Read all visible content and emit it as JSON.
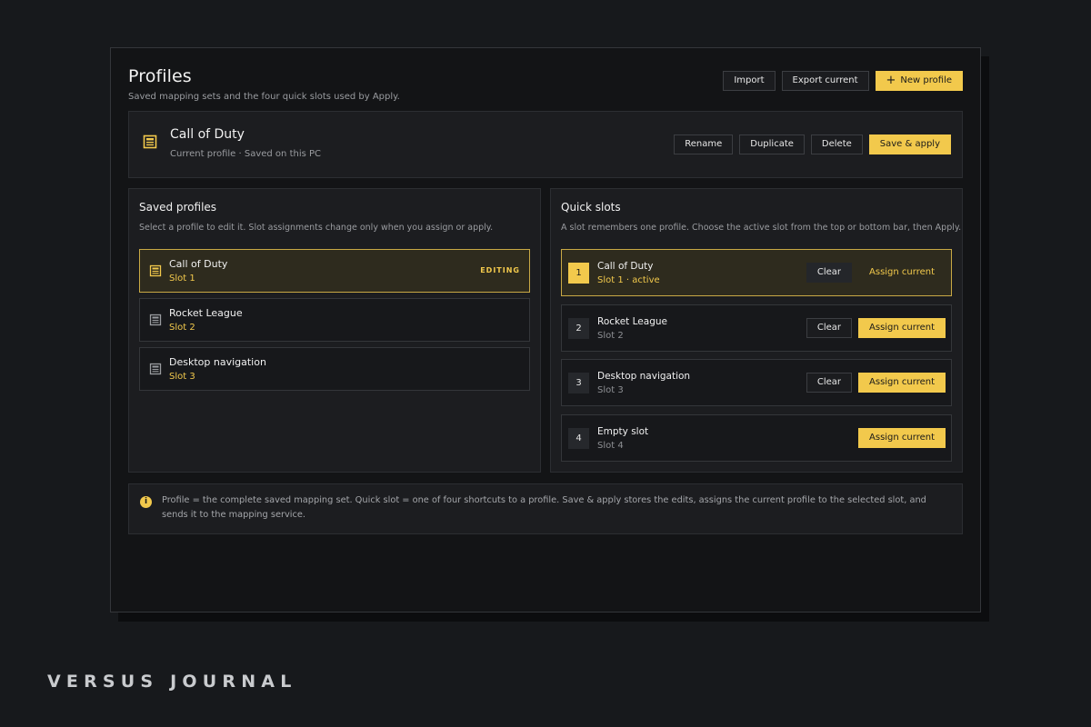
{
  "header": {
    "title": "Profiles",
    "subtitle": "Saved mapping sets and the four quick slots used by Apply.",
    "import_label": "Import",
    "export_label": "Export current",
    "new_profile_label": "New profile"
  },
  "current": {
    "name": "Call of Duty",
    "meta": "Current profile · Saved on this PC",
    "rename_label": "Rename",
    "duplicate_label": "Duplicate",
    "delete_label": "Delete",
    "save_apply_label": "Save & apply"
  },
  "saved_profiles": {
    "title": "Saved profiles",
    "description": "Select a profile to edit it. Slot assignments change only when you assign or apply.",
    "items": [
      {
        "name": "Call of Duty",
        "slot": "Slot 1",
        "badge": "EDITING"
      },
      {
        "name": "Rocket League",
        "slot": "Slot 2"
      },
      {
        "name": "Desktop navigation",
        "slot": "Slot 3"
      }
    ]
  },
  "quick_slots": {
    "title": "Quick slots",
    "description": "A slot remembers one profile. Choose the active slot from the top or bottom bar, then Apply.",
    "clear_label": "Clear",
    "assign_label": "Assign current",
    "slots": [
      {
        "number": "1",
        "name": "Call of Duty",
        "sub": "Slot 1 · active"
      },
      {
        "number": "2",
        "name": "Rocket League",
        "sub": "Slot 2"
      },
      {
        "number": "3",
        "name": "Desktop navigation",
        "sub": "Slot 3"
      },
      {
        "number": "4",
        "name": "Empty slot",
        "sub": "Slot 4"
      }
    ]
  },
  "info": {
    "icon": "info-icon",
    "glyph": "i",
    "text": "Profile = the complete saved mapping set. Quick slot = one of four shortcuts to a profile. Save & apply stores the edits, assigns the current profile to the selected slot, and sends it to the mapping service."
  },
  "brand": {
    "name": "VERSUS JOURNAL"
  },
  "colors": {
    "accent": "#f2c94c",
    "background": "#131416",
    "panel": "#1c1d20"
  }
}
